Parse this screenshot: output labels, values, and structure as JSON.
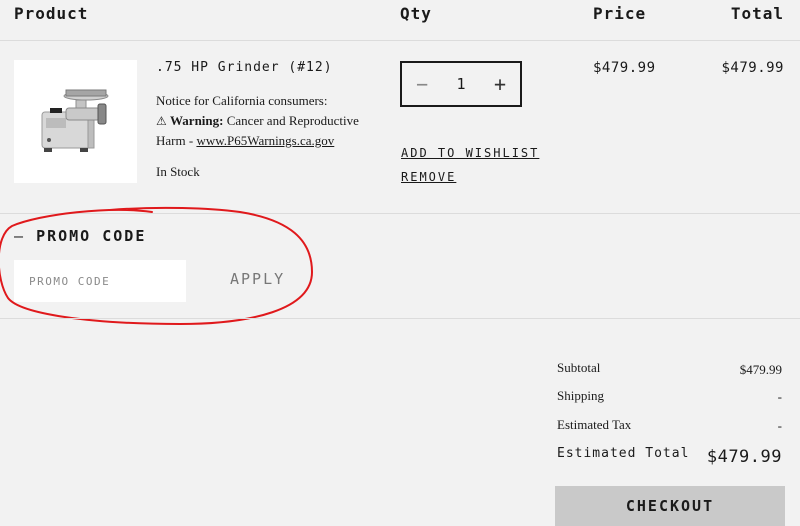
{
  "cart": {
    "headers": {
      "product": "Product",
      "qty": "Qty",
      "price": "Price",
      "total": "Total"
    },
    "item": {
      "title": ".75 HP Grinder (#12)",
      "notice_line": "Notice for California consumers:",
      "warning_symbol": "⚠",
      "warning_label": "Warning:",
      "warning_text": " Cancer and Reproductive Harm - ",
      "warning_link": "www.P65Warnings.ca.gov",
      "stock": "In Stock",
      "quantity": "1",
      "minus_symbol": "−",
      "plus_symbol": "+",
      "add_to_wishlist": "ADD TO WISHLIST",
      "remove": "REMOVE",
      "price": "$479.99",
      "total": "$479.99"
    }
  },
  "promo": {
    "toggle_symbol": "—",
    "heading": "PROMO CODE",
    "placeholder": "PROMO CODE",
    "apply_label": "APPLY"
  },
  "summary": {
    "subtotal_label": "Subtotal",
    "subtotal_value": "$479.99",
    "shipping_label": "Shipping",
    "shipping_value": "-",
    "tax_label": "Estimated Tax",
    "tax_value": "-",
    "total_label": "Estimated Total",
    "total_value": "$479.99",
    "checkout_label": "CHECKOUT"
  },
  "colors": {
    "page_background": "#f2f2f2",
    "checkout_background": "#c9c9c9",
    "annotation_red": "#e0191c"
  },
  "icons": {
    "product_image": "meat-grinder-image",
    "warning": "warning-triangle-icon",
    "decrease": "minus-icon",
    "increase": "plus-icon",
    "collapse": "collapse-dash-icon"
  }
}
